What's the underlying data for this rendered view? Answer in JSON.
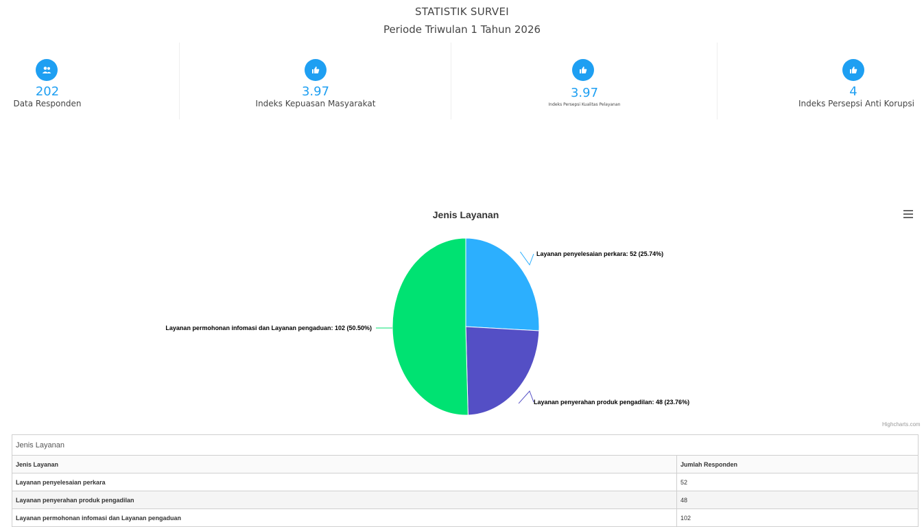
{
  "header": {
    "title": "STATISTIK SURVEI",
    "period": "Periode Triwulan 1 Tahun 2026"
  },
  "stats": [
    {
      "icon": "users-icon",
      "value": "202",
      "label": "Data Responden"
    },
    {
      "icon": "thumbs-up-icon",
      "value": "3.97",
      "label": "Indeks Kepuasan Masyarakat"
    },
    {
      "icon": "thumbs-up-icon",
      "value": "3.97",
      "label": "Indeks Persepsi Kualitas Pelayanan"
    },
    {
      "icon": "thumbs-up-icon",
      "value": "4",
      "label": "Indeks Persepsi Anti Korupsi"
    }
  ],
  "colors": {
    "accent": "#1e9ff2",
    "slice1": "#2caffe",
    "slice2": "#544fc5",
    "slice3": "#00e272"
  },
  "chart_data": {
    "type": "pie",
    "title": "Jenis Layanan",
    "slices": [
      {
        "name": "Layanan penyelesaian perkara",
        "value": 52,
        "percent": 25.74,
        "label": "Layanan penyelesaian perkara: 52 (25.74%)"
      },
      {
        "name": "Layanan penyerahan produk pengadilan",
        "value": 48,
        "percent": 23.76,
        "label": "Layanan penyerahan produk pengadilan: 48 (23.76%)"
      },
      {
        "name": "Layanan permohonan infomasi dan Layanan pengaduan",
        "value": 102,
        "percent": 50.5,
        "label": "Layanan permohonan infomasi dan Layanan pengaduan: 102 (50.50%)"
      }
    ],
    "credits": "Highcharts.com"
  },
  "table": {
    "caption": "Jenis Layanan",
    "headers": [
      "Jenis Layanan",
      "Jumlah Responden"
    ],
    "rows": [
      [
        "Layanan penyelesaian perkara",
        "52"
      ],
      [
        "Layanan penyerahan produk pengadilan",
        "48"
      ],
      [
        "Layanan permohonan infomasi dan Layanan pengaduan",
        "102"
      ]
    ]
  }
}
